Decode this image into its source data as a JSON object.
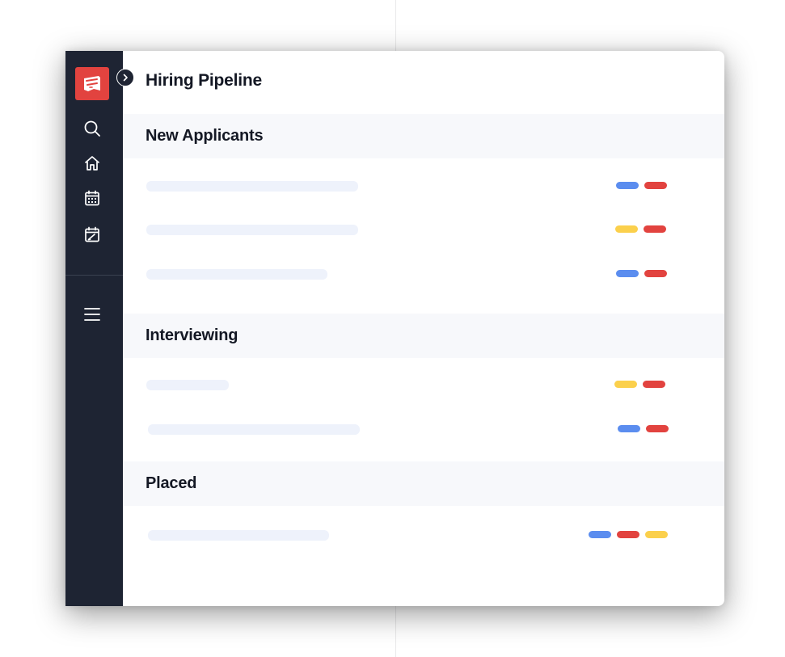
{
  "page": {
    "title": "Hiring Pipeline"
  },
  "sidebar": {
    "logo_icon": "flag-logo-icon",
    "toggle_icon": "chevron-right-icon",
    "items": [
      {
        "icon": "search-icon"
      },
      {
        "icon": "home-icon"
      },
      {
        "icon": "calendar-icon"
      },
      {
        "icon": "calendar-check-icon"
      },
      {
        "icon": "menu-icon"
      }
    ]
  },
  "colors": {
    "sidebar_bg": "#1e2433",
    "logo_bg": "#e2433f",
    "tag_blue": "#5b8def",
    "tag_red": "#e2433f",
    "tag_yellow": "#fbd04c",
    "skeleton": "#eef2fb",
    "section_bg": "#f7f8fb"
  },
  "sections": [
    {
      "title": "New Applicants",
      "rows": [
        {
          "tags": [
            "blue",
            "red"
          ]
        },
        {
          "tags": [
            "yellow",
            "red"
          ]
        },
        {
          "tags": [
            "blue",
            "red"
          ]
        }
      ]
    },
    {
      "title": "Interviewing",
      "rows": [
        {
          "tags": [
            "yellow",
            "red"
          ]
        },
        {
          "tags": [
            "blue",
            "red"
          ]
        }
      ]
    },
    {
      "title": "Placed",
      "rows": [
        {
          "tags": [
            "blue",
            "red",
            "yellow"
          ]
        }
      ]
    }
  ]
}
